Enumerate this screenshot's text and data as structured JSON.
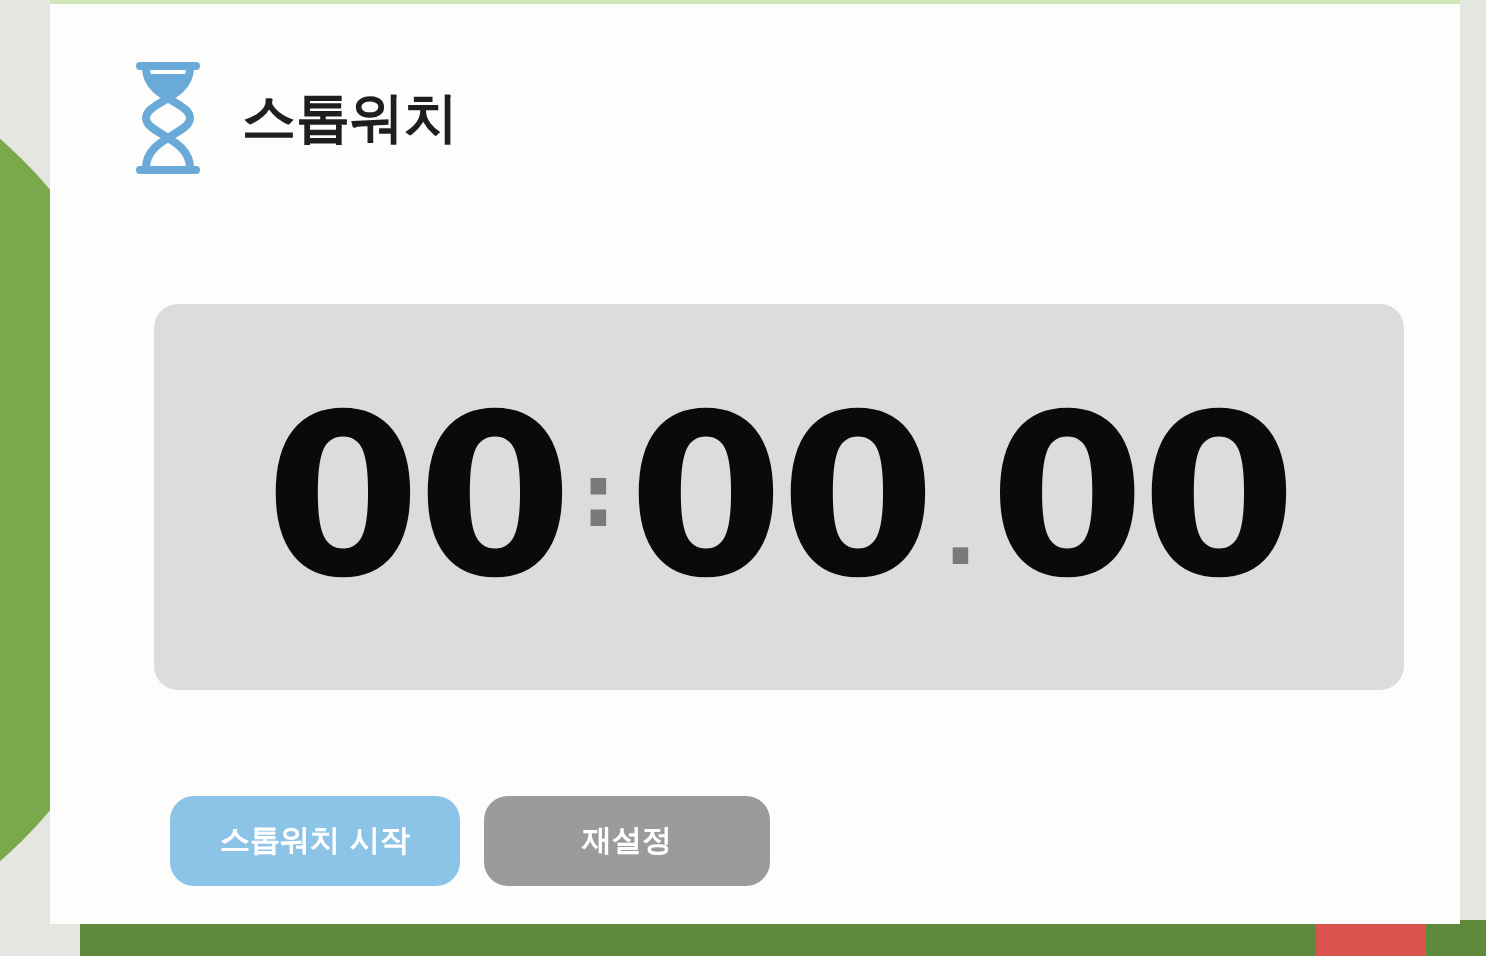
{
  "title": "스톱워치",
  "display": {
    "minutes": "00",
    "separator_1": ":",
    "seconds": "00",
    "separator_2": ".",
    "hundredths": "00"
  },
  "buttons": [
    {
      "label": "스톱워치 시작",
      "kind": "primary"
    },
    {
      "label": "재설정",
      "kind": "secondary"
    }
  ]
}
